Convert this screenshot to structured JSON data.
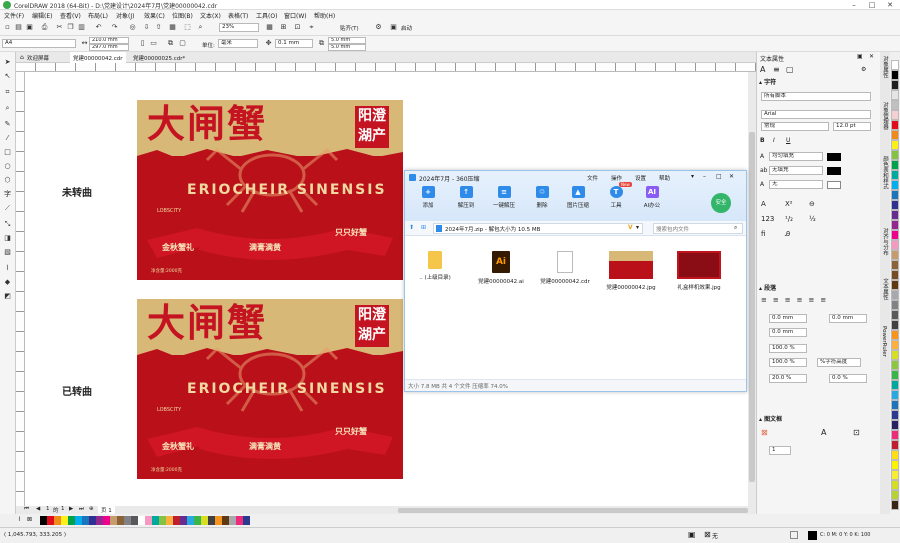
{
  "window": {
    "title": "CorelDRAW 2018 (64-Bit) - D:\\党建设计\\2024年7月\\党建00000042.cdr"
  },
  "menu": [
    "文件(F)",
    "编辑(E)",
    "查看(V)",
    "布局(L)",
    "对象(J)",
    "效果(C)",
    "位图(B)",
    "文本(X)",
    "表格(T)",
    "工具(O)",
    "窗口(W)",
    "帮助(H)"
  ],
  "toolbar": {
    "zoom": "23%",
    "snap": "贴齐(T)",
    "launch": "启动"
  },
  "propbar": {
    "page_size": "A4",
    "width": "210.0 mm",
    "height": "297.0 mm",
    "units_label": "单位:",
    "units": "毫米",
    "nudge": "0.1 mm",
    "dup_x": "5.0 mm",
    "dup_y": "5.0 mm"
  },
  "doc_tabs": [
    "欢迎屏幕",
    "党建00000042.cdr",
    "党建00000025.cdr*"
  ],
  "canvas": {
    "label_top": "未转曲",
    "label_bottom": "已转曲"
  },
  "art": {
    "title": "大闸蟹",
    "stamp": "阳澄湖产",
    "arc": "ERIOCHEIR SINENSIS",
    "ribbon_left": "金秋蟹礼",
    "ribbon_center": "满膏满黄",
    "ribbon_right": "只只好蟹",
    "logo": "LOBSCITY",
    "weight": "净含量:2000克"
  },
  "page_nav": {
    "current": "1",
    "of": "的",
    "total": "1",
    "tab": "页 1"
  },
  "explorer": {
    "title": "2024年7月 - 360压缩",
    "menu": [
      "文件",
      "操作",
      "设置",
      "帮助"
    ],
    "buttons": [
      {
        "label": "添加",
        "color": "#2e8bea",
        "glyph": "+"
      },
      {
        "label": "解压到",
        "color": "#2e8bea",
        "glyph": "↑"
      },
      {
        "label": "一键解压",
        "color": "#2e8bea",
        "glyph": "≡"
      },
      {
        "label": "删除",
        "color": "#2e8bea",
        "glyph": "♲"
      },
      {
        "label": "图片压缩",
        "color": "#2e8bea",
        "glyph": "▲"
      },
      {
        "label": "工具",
        "color": "#2e8bea",
        "glyph": "T"
      },
      {
        "label": "AI办公",
        "color": "#8a5cf6",
        "glyph": "AI"
      }
    ],
    "new_badge": "New",
    "safe": "安全",
    "path": "2024年7月.zip - 解包大小为 10.5 MB",
    "search_placeholder": "搜索包内文件",
    "files": [
      {
        "name": ".. (上级目录)",
        "icon": "folder-icon"
      },
      {
        "name": "党建00000042.ai",
        "icon": "ai-file-icon"
      },
      {
        "name": "党建00000042.cdr",
        "icon": "cdr-file-icon"
      },
      {
        "name": "党建00000042.jpg",
        "icon": "jpg-thumbnail-icon"
      },
      {
        "name": "礼盒样机效果.jpg",
        "icon": "jpg-thumbnail-icon"
      }
    ],
    "status": "大小 7.8 MB 共 4 个文件 压缩率 74.0%"
  },
  "right_panel": {
    "title": "文本属性",
    "char_header": "字符",
    "script": "所有脚本",
    "font": "Arial",
    "style": "常规",
    "size": "12.0 pt",
    "fill": "均匀填充",
    "bg": "无填充",
    "outline": "无",
    "para_header": "段落",
    "indent1": "0.0 mm",
    "indent2": "0.0 mm",
    "indent3": "0.0 mm",
    "spacing1": "100.0 %",
    "spacing2": "100.0 %",
    "spacing_mode": "%字符高度",
    "spacing3": "20.0 %",
    "spacing4": "0.0 %",
    "frame_header": "图文框",
    "columns": "1"
  },
  "side_tabs": [
    "对象属性",
    "对象管理器",
    "颜色表和样式",
    "对齐与分布",
    "文本属性",
    "PowerRuler"
  ],
  "status": {
    "coords": "( 1,045.793, 333.205 )",
    "fill_none": "无",
    "color_info": "C: 0 M: 0 Y: 0 K: 100"
  },
  "colors": {
    "red": "#b9101a",
    "gold": "#d8b877",
    "accent": "#2e8bea"
  },
  "palette": [
    "#ffffff",
    "#000000",
    "#1f1f1f",
    "#e5e5e5",
    "#c0c0c0",
    "#f4d0d0",
    "#e10c1b",
    "#f08a1c",
    "#fdf018",
    "#83c341",
    "#00a14b",
    "#00a99d",
    "#00aeef",
    "#1b75bc",
    "#2e3192",
    "#662d91",
    "#92278f",
    "#ec008c",
    "#f49ac1",
    "#c69c6d",
    "#8c6239",
    "#754c24",
    "#603913",
    "#a7a9ac",
    "#808285",
    "#58595b",
    "#414042",
    "#f7941d",
    "#fbb040",
    "#d7df23",
    "#8dc63f",
    "#39b54a",
    "#00a79d",
    "#27aae1",
    "#1c75bc",
    "#2b3990",
    "#262262",
    "#ee2a7b",
    "#be1e2d",
    "#ffde17",
    "#fff200",
    "#f9ed32",
    "#d6de23",
    "#b7d333",
    "#3c2415"
  ],
  "bottom_palette": [
    "#000000",
    "#e10c1b",
    "#f08a1c",
    "#fdf018",
    "#00a14b",
    "#00aeef",
    "#1b75bc",
    "#2e3192",
    "#92278f",
    "#ec008c",
    "#c69c6d",
    "#8c6239",
    "#808285",
    "#58595b",
    "#ffffff",
    "#f49ac1",
    "#00a99d",
    "#83c341",
    "#fbb040",
    "#be1e2d",
    "#662d91",
    "#27aae1",
    "#39b54a",
    "#d7df23",
    "#414042",
    "#f7941d",
    "#603913",
    "#a7a9ac",
    "#ee2a7b",
    "#2b3990"
  ]
}
